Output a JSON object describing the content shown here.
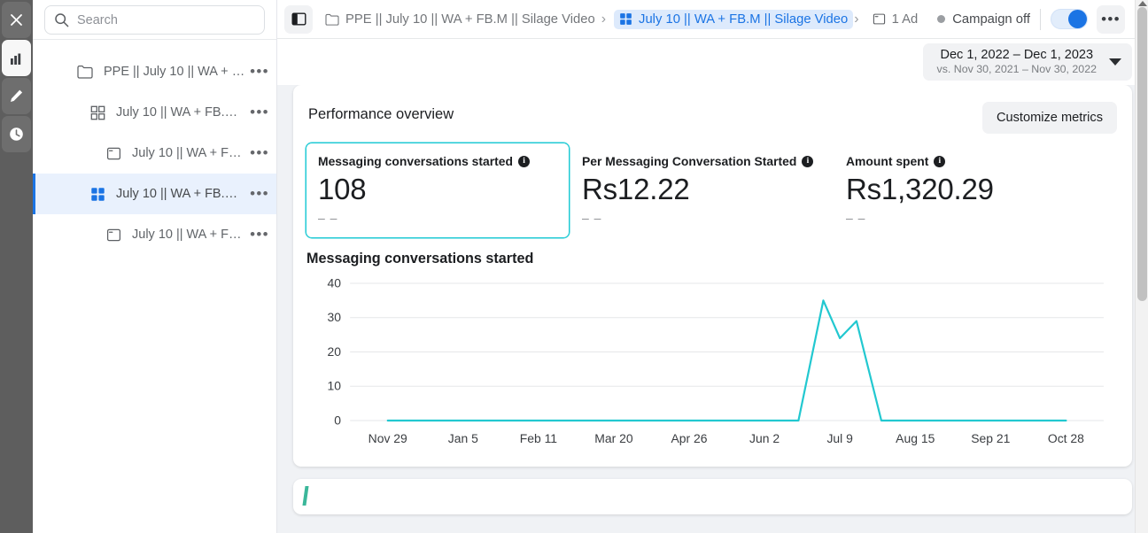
{
  "rail": {
    "items": [
      {
        "name": "close-icon",
        "label": "Close",
        "active": false
      },
      {
        "name": "chart-icon",
        "label": "Analytics",
        "active": true
      },
      {
        "name": "pencil-icon",
        "label": "Edit",
        "active": false
      },
      {
        "name": "clock-icon",
        "label": "History",
        "active": false
      }
    ]
  },
  "sidebar": {
    "search": {
      "placeholder": "Search",
      "value": "",
      "icon": "search-icon"
    },
    "tree": [
      {
        "icon": "folder-icon",
        "label": "PPE || July 10 || WA + FB.M ...",
        "indent": 0,
        "selected": false,
        "menu": "•••"
      },
      {
        "icon": "grid-outline-icon",
        "label": "July 10 || WA + FB.M || Si...",
        "indent": 1,
        "selected": false,
        "menu": "•••"
      },
      {
        "icon": "ad-card-icon",
        "label": "July 10 || WA + FB.M ||...",
        "indent": 2,
        "selected": false,
        "menu": "•••"
      },
      {
        "icon": "grid-filled-icon",
        "label": "July 10 || WA + FB.M || Si...",
        "indent": 1,
        "selected": true,
        "menu": "•••"
      },
      {
        "icon": "ad-card-icon",
        "label": "July 10 || WA + FB.M ||...",
        "indent": 2,
        "selected": false,
        "menu": "•••"
      }
    ]
  },
  "topbar": {
    "panel_toggle_icon": "panel-toggle-icon",
    "breadcrumb": [
      {
        "icon": "folder-icon",
        "label": "PPE || July 10 || WA + FB.M || Silage Video",
        "active": false
      },
      {
        "icon": "grid-filled-icon",
        "label": "July 10 || WA + FB.M || Silage Video",
        "active": true
      },
      {
        "icon": "ad-card-icon",
        "label": "1 Ad",
        "active": false
      }
    ],
    "separator": "❯",
    "status": "Campaign off",
    "toggle_on": true,
    "more_label": "•••"
  },
  "date_range": {
    "primary": "Dec 1, 2022 – Dec 1, 2023",
    "comparison": "vs. Nov 30, 2021 – Nov 30, 2022",
    "caret_icon": "chevron-down-icon"
  },
  "performance": {
    "title": "Performance overview",
    "customize_label": "Customize metrics",
    "metrics": [
      {
        "label": "Messaging conversations started",
        "value": "108",
        "delta": "– –",
        "selected": true,
        "info_icon": "info-icon"
      },
      {
        "label": "Per Messaging Conversation Started",
        "value": "Rs12.22",
        "delta": "– –",
        "selected": false,
        "info_icon": "info-icon"
      },
      {
        "label": "Amount spent",
        "value": "Rs1,320.29",
        "delta": "– –",
        "selected": false,
        "info_icon": "info-icon"
      }
    ]
  },
  "chart_data": {
    "type": "line",
    "title": "Messaging conversations started",
    "xlabel": "",
    "ylabel": "",
    "ylim": [
      0,
      40
    ],
    "yticks": [
      0,
      10,
      20,
      30,
      40
    ],
    "grid": true,
    "legend": null,
    "line_color": "#22c8d0",
    "categories": [
      "Nov 29",
      "Jan 5",
      "Feb 11",
      "Mar 20",
      "Apr 26",
      "Jun 2",
      "Jul 9",
      "Aug 15",
      "Sep 21",
      "Oct 28"
    ],
    "series": [
      {
        "name": "Messaging conversations started",
        "x": [
          "Nov 29",
          "Jan 5",
          "Feb 11",
          "Mar 20",
          "Apr 26",
          "Jun 2",
          "Jul 5",
          "Jul 7",
          "Jul 9",
          "Jul 11",
          "Jul 13",
          "Aug 15",
          "Sep 21",
          "Oct 28"
        ],
        "values": [
          0,
          0,
          0,
          0,
          0,
          0,
          0,
          35,
          24,
          29,
          0,
          0,
          0,
          0
        ]
      }
    ]
  },
  "scrollbar": {
    "visible": true
  }
}
